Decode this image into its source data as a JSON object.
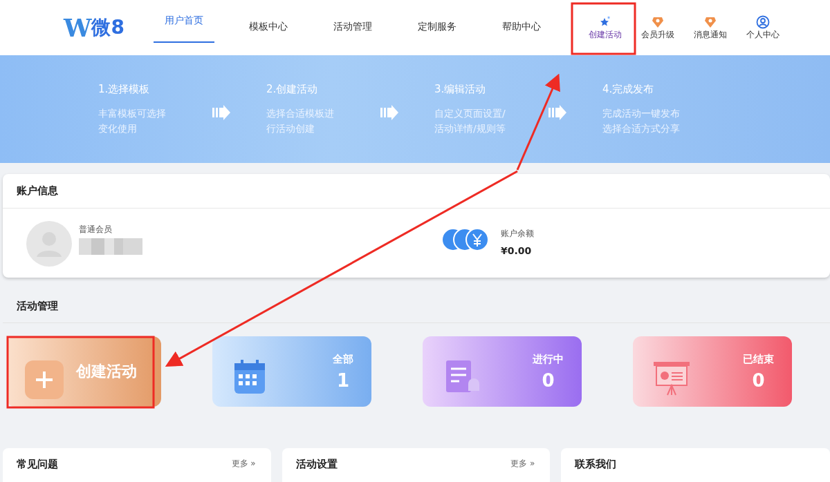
{
  "logo": {
    "mark": "W",
    "text": "微8"
  },
  "nav": [
    {
      "label": "用户首页",
      "selected": true
    },
    {
      "label": "模板中心",
      "selected": false
    },
    {
      "label": "活动管理",
      "selected": false
    },
    {
      "label": "定制服务",
      "selected": false
    },
    {
      "label": "帮助中心",
      "selected": false
    }
  ],
  "actions": [
    {
      "label": "创建活动",
      "kind": "star"
    },
    {
      "label": "会员升级",
      "kind": "badge"
    },
    {
      "label": "消息通知",
      "kind": "badge"
    },
    {
      "label": "个人中心",
      "kind": "user"
    }
  ],
  "steps": [
    {
      "title": "1.选择模板",
      "lines": [
        "丰富模板可选择",
        "变化使用"
      ]
    },
    {
      "title": "2.创建活动",
      "lines": [
        "选择合适模板进",
        "行活动创建"
      ]
    },
    {
      "title": "3.编辑活动",
      "lines": [
        "自定义页面设置/",
        "活动详情/规则等"
      ]
    },
    {
      "title": "4.完成发布",
      "lines": [
        "完成活动一键发布",
        "选择合适方式分享"
      ]
    }
  ],
  "account": {
    "title": "账户信息",
    "member_level": "普通会员",
    "balance_label": "账户余额",
    "balance": "¥0.00"
  },
  "activity": {
    "title": "活动管理",
    "cards": [
      {
        "kind": "create",
        "label": "创建活动"
      },
      {
        "kind": "calendar",
        "label": "全部",
        "count": "1"
      },
      {
        "kind": "doc",
        "label": "进行中",
        "count": "0"
      },
      {
        "kind": "board",
        "label": "已结束",
        "count": "0"
      }
    ]
  },
  "panels": [
    {
      "title": "常见问题",
      "more": "更多 »"
    },
    {
      "title": "活动设置",
      "more": "更多 »"
    },
    {
      "title": "联系我们"
    }
  ]
}
